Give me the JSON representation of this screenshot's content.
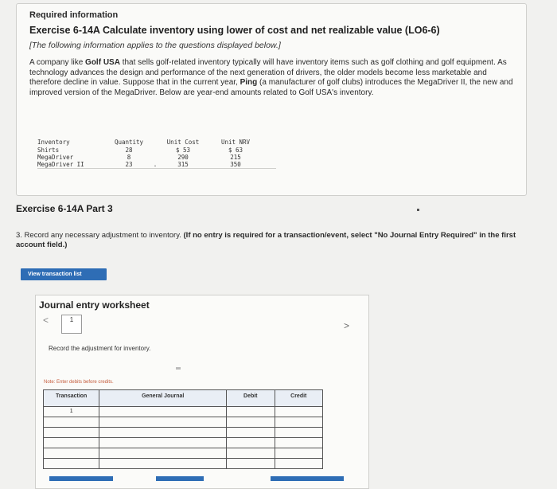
{
  "header": {
    "required": "Required information",
    "exercise_title": "Exercise 6-14A Calculate inventory using lower of cost and net realizable value (LO6-6)",
    "intro": "[The following information applies to the questions displayed below.]",
    "para_1": "A company like ",
    "para_company": "Golf USA",
    "para_2": " that sells golf-related inventory typically will have inventory items such as golf clothing and golf equipment. As technology advances the design and performance of the next generation of drivers, the older models become less marketable and therefore decline in value. Suppose that in the current year, ",
    "para_ping": "Ping",
    "para_3": " (a manufacturer of golf clubs) introduces the MegaDriver II, the new and improved version of the MegaDriver. Below are year-end amounts related to Golf USA's inventory."
  },
  "inventory": {
    "columns": [
      "Inventory",
      "Quantity",
      "Unit Cost",
      "Unit NRV"
    ],
    "rows": [
      {
        "item": "Shirts",
        "quantity": "28",
        "cost": "$ 53",
        "nrv": "$ 63"
      },
      {
        "item": "MegaDriver",
        "quantity": "8",
        "cost": "290",
        "nrv": "215"
      },
      {
        "item": "MegaDriver II",
        "quantity": "23",
        "cost": "315",
        "nrv": "350"
      }
    ],
    "dot": "."
  },
  "part": {
    "title": "Exercise 6-14A Part 3",
    "question_text": "3. Record any necessary adjustment to inventory. ",
    "question_bold": "(If no entry is required for a transaction/event, select \"No Journal Entry Required\" in the first account field.)"
  },
  "buttons": {
    "view_transaction": "View transaction list"
  },
  "worksheet": {
    "title": "Journal entry worksheet",
    "prev": "<",
    "next": ">",
    "page": "1",
    "instruction": "Record the adjustment for inventory.",
    "note": "Note: Enter debits before credits.",
    "columns": [
      "Transaction",
      "General Journal",
      "Debit",
      "Credit"
    ],
    "first_transaction": "1"
  },
  "colors": {
    "accent": "#2e6db5",
    "note": "#c45a3a"
  }
}
